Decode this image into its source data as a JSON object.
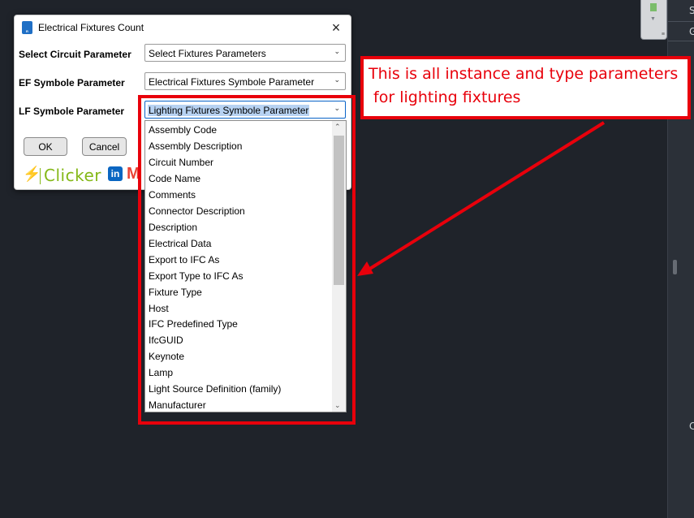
{
  "dialog": {
    "title": "Electrical Fixtures Count",
    "app_icon": "R",
    "close_icon": "×",
    "fields": [
      {
        "label": "Select Circuit Parameter",
        "value": "Select Fixtures Parameters"
      },
      {
        "label": "EF Symbole Parameter",
        "value": "Electrical Fixtures Symbole Parameter"
      },
      {
        "label": "LF Symbole Parameter",
        "value": "Lighting Fixtures Symbole Parameter"
      }
    ],
    "ok_label": "OK",
    "cancel_label": "Cancel",
    "logo_text": "Clicker",
    "linkedin": "in",
    "gmail": "M"
  },
  "dropdown": {
    "items": [
      "Assembly Code",
      "Assembly Description",
      "Circuit Number",
      "Code Name",
      "Comments",
      "Connector Description",
      "Description",
      "Electrical Data",
      "Export to IFC As",
      "Export Type to IFC As",
      "Fixture Type",
      "Host",
      "IFC Predefined Type",
      "IfcGUID",
      "Keynote",
      "Lamp",
      "Light Source Definition (family)",
      "Manufacturer"
    ]
  },
  "annotation": {
    "line1": "This is all instance and type parameters",
    "line2": " for lighting fixtures",
    "color": "#e8000b"
  },
  "right_panel": {
    "items": [
      "S",
      "G",
      "C"
    ]
  },
  "icons": {
    "chevron": "chevron-down-icon",
    "close": "close-icon",
    "app": "revit-app-icon",
    "linkedin": "linkedin-icon",
    "gmail": "gmail-icon"
  }
}
